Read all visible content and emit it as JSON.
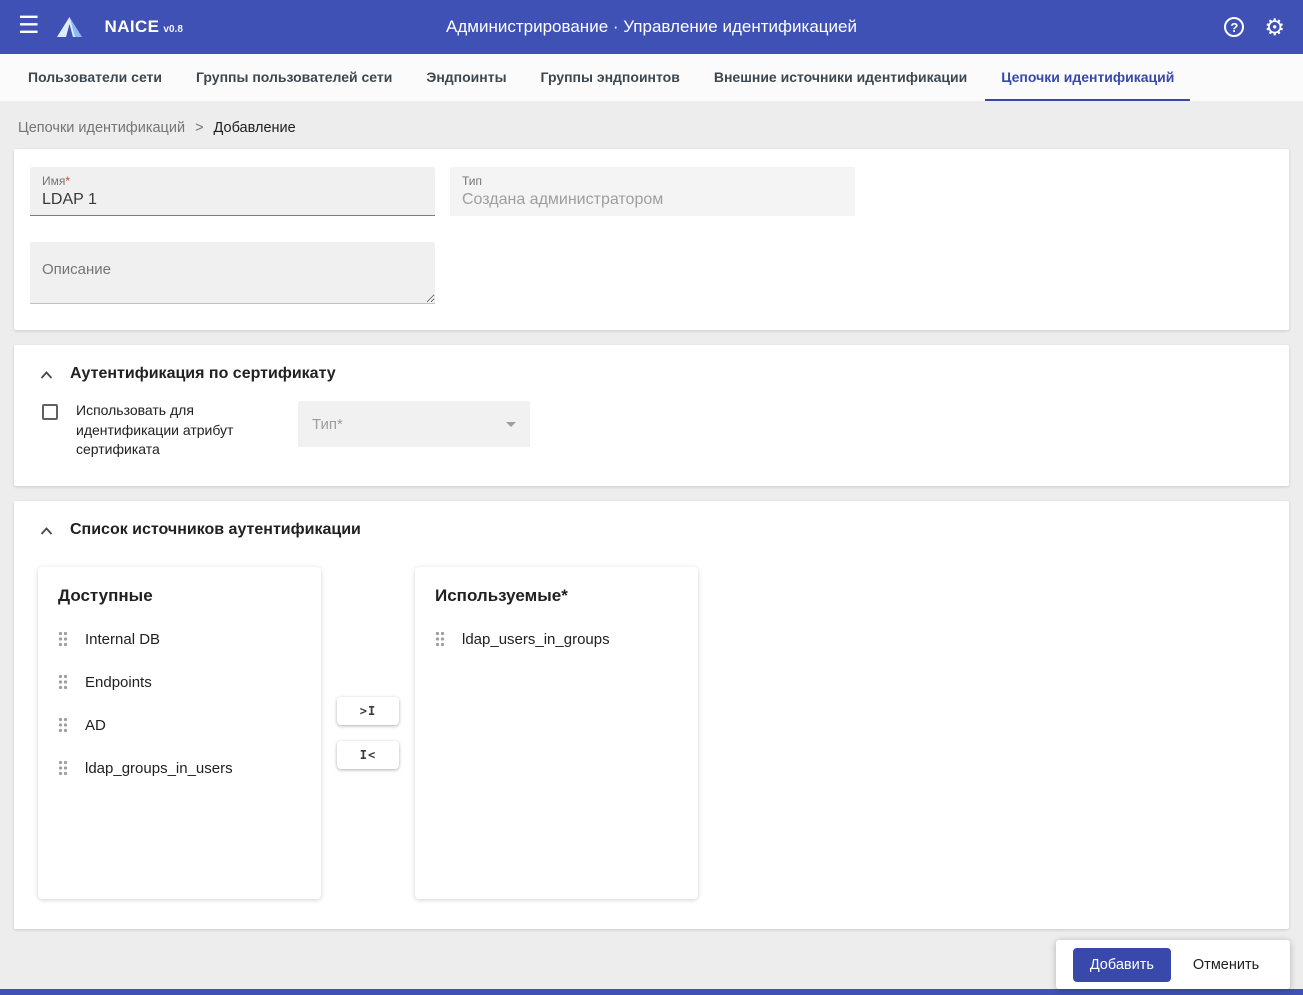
{
  "header": {
    "app_name": "NAICE",
    "app_version": "v0.8",
    "title": "Администрирование · Управление идентификацией"
  },
  "tabs": [
    {
      "label": "Пользователи сети"
    },
    {
      "label": "Группы пользователей сети"
    },
    {
      "label": "Эндпоинты"
    },
    {
      "label": "Группы эндпоинтов"
    },
    {
      "label": "Внешние источники идентификации"
    },
    {
      "label": "Цепочки идентификаций",
      "active": true
    }
  ],
  "breadcrumb": {
    "root": "Цепочки идентификаций",
    "separator": ">",
    "current": "Добавление"
  },
  "form": {
    "name": {
      "label": "Имя",
      "required_marker": "*",
      "value": "LDAP 1"
    },
    "type": {
      "label": "Тип",
      "value": "Создана администратором"
    },
    "description": {
      "placeholder": "Описание"
    }
  },
  "cert_auth": {
    "title": "Аутентификация по сертификату",
    "checkbox_label": "Использовать для идентификации атрибут сертификата",
    "checkbox_checked": false,
    "type_select_placeholder": "Тип*"
  },
  "auth_sources": {
    "title": "Список источников аутентификации",
    "available": {
      "title": "Доступные",
      "items": [
        "Internal DB",
        "Endpoints",
        "AD",
        "ldap_groups_in_users"
      ]
    },
    "used": {
      "title": "Используемые*",
      "items": [
        "ldap_users_in_groups"
      ]
    },
    "move_all_right_label": ">I",
    "move_all_left_label": "I<"
  },
  "actions": {
    "add_label": "Добавить",
    "cancel_label": "Отменить"
  },
  "colors": {
    "primary": "#3f51b5",
    "accent": "#3949ab",
    "required": "#e53935"
  }
}
